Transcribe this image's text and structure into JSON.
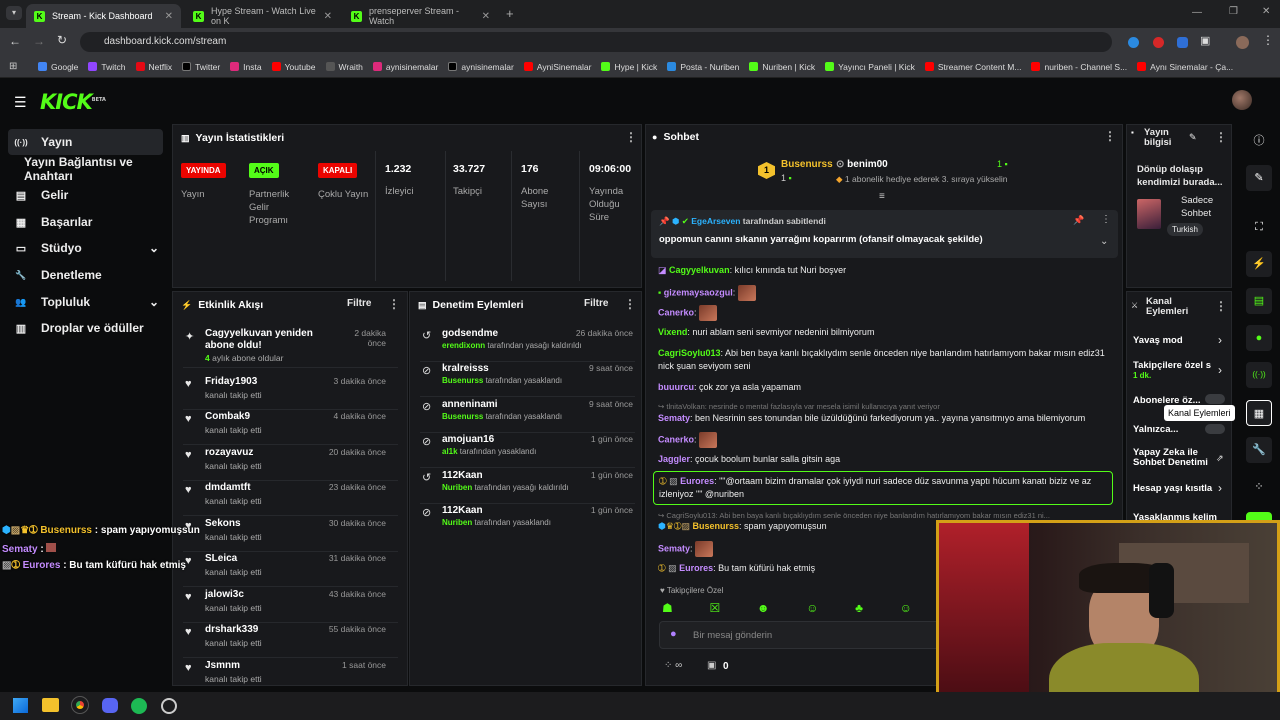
{
  "browser": {
    "tabs": [
      {
        "title": "Stream - Kick Dashboard"
      },
      {
        "title": "Hype Stream - Watch Live on K"
      },
      {
        "title": "prenseperver Stream - Watch"
      }
    ],
    "url": "dashboard.kick.com/stream",
    "bookmarks": [
      "Google",
      "Twitch",
      "Netflix",
      "Twitter",
      "Insta",
      "Youtube",
      "Wraith",
      "aynisinemalar",
      "aynisinemalar",
      "AyniSinemalar",
      "Hype | Kick",
      "Posta - Nuriben",
      "Nuriben | Kick",
      "Yayıncı Paneli | Kick",
      "Streamer Content M...",
      "nuriben - Channel S...",
      "Aynı Sinemalar - Ça..."
    ]
  },
  "logo": "KICK",
  "logo_sup": "BETA",
  "sidebar": [
    {
      "icon": "broadcast-icon",
      "glyph": "((·))",
      "label": "Yayın"
    },
    {
      "icon": "",
      "glyph": "",
      "label": "Yayın Bağlantısı ve Anahtarı"
    },
    {
      "icon": "revenue-icon",
      "glyph": "▤",
      "label": "Gelir"
    },
    {
      "icon": "achievements-icon",
      "glyph": "▦",
      "label": "Başarılar"
    },
    {
      "icon": "studio-icon",
      "glyph": "▭",
      "label": "Stüdyo"
    },
    {
      "icon": "moderation-icon",
      "glyph": "🔧",
      "label": "Denetleme"
    },
    {
      "icon": "community-icon",
      "glyph": "👥",
      "label": "Topluluk"
    },
    {
      "icon": "drops-icon",
      "glyph": "▥",
      "label": "Droplar ve ödüller"
    }
  ],
  "stats": {
    "title": "Yayın İstatistikleri",
    "badges": [
      {
        "badge": "YAYINDA",
        "label": "Yayın"
      },
      {
        "badge": "AÇIK",
        "label": "Partnerlik Gelir Programı"
      },
      {
        "badge": "KAPALI",
        "label": "Çoklu Yayın"
      }
    ],
    "values": [
      {
        "value": "1.232",
        "label": "İzleyici"
      },
      {
        "value": "33.727",
        "label": "Takipçi"
      },
      {
        "value": "176",
        "label": "Abone Sayısı"
      },
      {
        "value": "09:06:00",
        "label": "Yayında Olduğu Süre"
      }
    ]
  },
  "activity": {
    "title": "Etkinlik Akışı",
    "filter": "Filtre",
    "items": [
      {
        "name": "Cagyyelkuvan yeniden abone oldu!",
        "sub_num": "4",
        "sub": " aylık abone oldular",
        "time": "2 dakika önce"
      },
      {
        "name": "Friday1903",
        "sub": "kanalı takip etti",
        "time": "3 dakika önce"
      },
      {
        "name": "Combak9",
        "sub": "kanalı takip etti",
        "time": "4 dakika önce"
      },
      {
        "name": "rozayavuz",
        "sub": "kanalı takip etti",
        "time": "20 dakika önce"
      },
      {
        "name": "dmdamtft",
        "sub": "kanalı takip etti",
        "time": "23 dakika önce"
      },
      {
        "name": "Sekons",
        "sub": "kanalı takip etti",
        "time": "30 dakika önce"
      },
      {
        "name": "SLeica",
        "sub": "kanalı takip etti",
        "time": "31 dakika önce"
      },
      {
        "name": "jalowi3c",
        "sub": "kanalı takip etti",
        "time": "43 dakika önce"
      },
      {
        "name": "drshark339",
        "sub": "kanalı takip etti",
        "time": "55 dakika önce"
      },
      {
        "name": "Jsmnm",
        "sub": "kanalı takip etti",
        "time": "1 saat önce"
      }
    ]
  },
  "modlog": {
    "title": "Denetim Eylemleri",
    "filter": "Filtre",
    "items": [
      {
        "name": "godsendme",
        "by": "erendixonn",
        "action": " tarafından yasağı kaldırıldı",
        "time": "26 dakika önce"
      },
      {
        "name": "kralreisss",
        "by": "Busenurss",
        "action": " tarafından yasaklandı",
        "time": "9 saat önce"
      },
      {
        "name": "anneninami",
        "by": "Busenurss",
        "action": " tarafından yasaklandı",
        "time": "9 saat önce"
      },
      {
        "name": "amojuan16",
        "by": "al1k",
        "action": " tarafından yasaklandı",
        "time": "1 gün önce"
      },
      {
        "name": "112Kaan",
        "by": "Nuriben",
        "action": " tarafından yasağı kaldırıldı",
        "time": "1 gün önce"
      },
      {
        "name": "112Kaan",
        "by": "Nuriben",
        "action": " tarafından yasaklandı",
        "time": "1 gün önce"
      }
    ]
  },
  "chat": {
    "title": "Sohbet",
    "gift": {
      "user": "Busenurss",
      "count": "1",
      "user2": "benim00",
      "count2": "1",
      "text": "1 abonelik hediye ederek 3. sıraya yükselin"
    },
    "pinned": {
      "by": "EgeArseven",
      "by_suffix": " tarafından sabitlendi",
      "text": "oppomun canını sıkanın yarrağını koparırım (ofansif olmayacak şekilde)"
    },
    "messages": [
      {
        "user": "Cagyyelkuvan",
        "color": "#c48cff",
        "text": ": kılıcı kınında tut Nuri boşver"
      },
      {
        "user": "gizemaysaozgul",
        "color": "#c48cff",
        "text": ":"
      },
      {
        "user": "Canerko",
        "color": "#c48cff",
        "text": ":"
      },
      {
        "user": "Vixend",
        "color": "#53fc18",
        "text": ": nuri ablam seni sevmiyor nedenini bilmiyorum"
      },
      {
        "user": "CagriSoylu013",
        "color": "#53fc18",
        "text": ": Abi ben baya kanlı bıçaklıydım senle önceden niye banlandım hatırlamıyom bakar mısın ediz31 nick şuan seviyom seni"
      },
      {
        "user": "buuurcu",
        "color": "#c48cff",
        "text": ": çok zor ya asla yapamam"
      },
      {
        "user": "",
        "color": "#888",
        "text": "tlnitaVolkan: nesrinde o mental fazlasıyla var mesela isimil kullanıcıya yanıt veriyor"
      },
      {
        "user": "Sematy",
        "color": "#c48cff",
        "text": ": ben Nesrinin ses tonundan bile üzüldüğünü farkediyorum ya.. yayına yansıtmıyo ama bilemiyorum"
      },
      {
        "user": "Canerko",
        "color": "#c48cff",
        "text": ":"
      },
      {
        "user": "Jaggler",
        "color": "#c48cff",
        "text": ": çocuk boolum bunlar salla gitsin aga"
      },
      {
        "user": "Eurores",
        "color": "#c48cff",
        "text": ": \"\"@ortaam bizim dramalar çok iyiydi nuri sadece düz savunma yaptı hücum kanatı biziz ve az izleniyoz \"\" @nuriben"
      },
      {
        "user": "",
        "color": "#888",
        "text": "CagriSoylu013: Abi ben baya kanlı bıçaklıydım senle önceden niye banlandım hatırlamıyom bakar mısın ediz31 ni..."
      },
      {
        "user": "Busenurss",
        "color": "#f3c12c",
        "text": ": spam yapıyomuşsun"
      },
      {
        "user": "Sematy",
        "color": "#c48cff",
        "text": ":"
      },
      {
        "user": "Eurores",
        "color": "#c48cff",
        "text": ": Bu tam küfürü hak etmiş"
      }
    ],
    "followers_only": "Takipçilere Özel",
    "input_placeholder": "Bir mesaj gönderin",
    "bottom_count": "0"
  },
  "stream_info": {
    "title": "Yayın bilgisi",
    "desc": "Dönüp dolaşıp kendimizi burada...",
    "category": "Sadece Sohbet",
    "tag": "Turkish"
  },
  "channel_actions": {
    "title": "Kanal Eylemleri",
    "items": [
      {
        "label": "Yavaş mod"
      },
      {
        "label": "Takipçilere özel s",
        "sub": "1 dk."
      },
      {
        "label": "Abonelere öz..."
      },
      {
        "label": "Yalnızca..."
      },
      {
        "label": "Yapay Zeka ile Sohbet Denetimi"
      },
      {
        "label": "Hesap yaşı kısıtla"
      },
      {
        "label": "Yasaklanmış kelim"
      }
    ],
    "tooltip": "Kanal Eylemleri"
  },
  "overlay_chat": [
    {
      "user": "Busenurss",
      "text": " : spam yapıyomuşsun",
      "color": "#f3c12c"
    },
    {
      "user": "Sematy",
      "text": " :",
      "color": "#c48cff"
    },
    {
      "user": "Eurores",
      "text": " : Bu tam küfürü hak etmiş",
      "color": "#c48cff"
    }
  ],
  "colors": {
    "accent": "#53fc18",
    "live": "#eb0400",
    "bg": "#0b0c0d",
    "panel": "#18191c"
  }
}
